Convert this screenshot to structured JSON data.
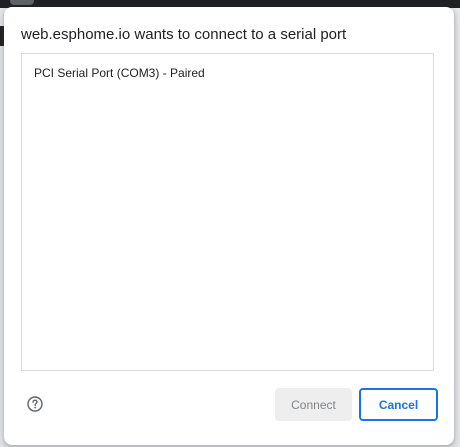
{
  "dialog": {
    "title": "web.esphome.io wants to connect to a serial port",
    "devices": [
      {
        "label": "PCI Serial Port (COM3) - Paired"
      }
    ],
    "help_icon": "help-circle-icon",
    "connect_label": "Connect",
    "cancel_label": "Cancel",
    "accent_color": "#1a73e8",
    "disabled_text_color": "#80868b"
  }
}
